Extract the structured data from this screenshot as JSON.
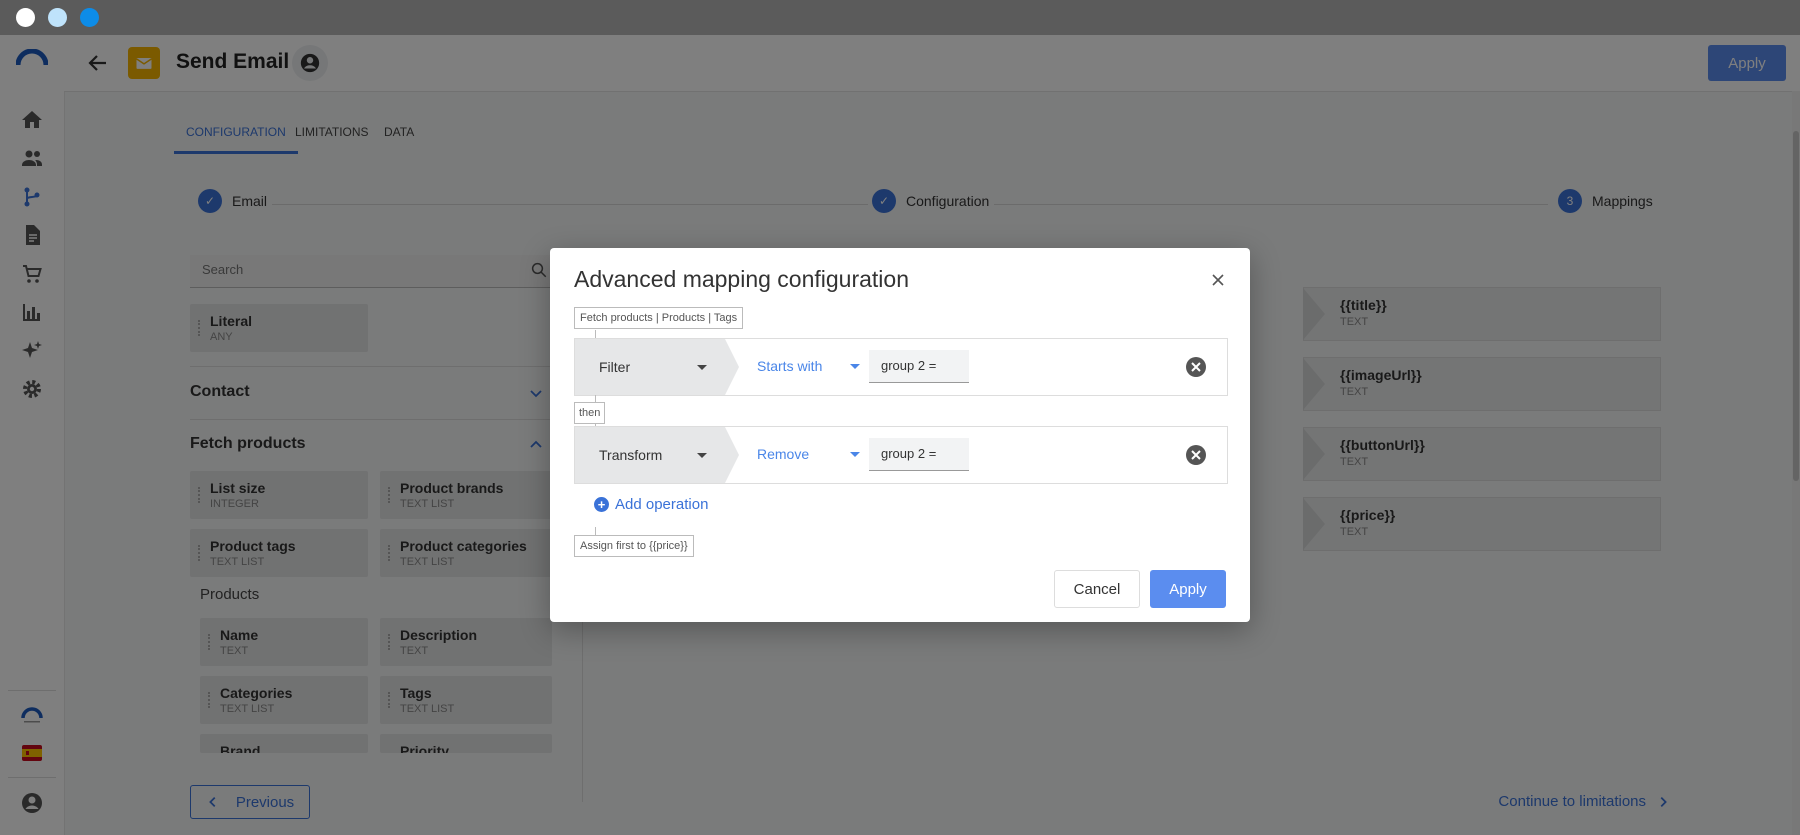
{
  "window": {
    "title_dots": [
      "close",
      "minimize",
      "zoom"
    ]
  },
  "header": {
    "title": "Send Email",
    "apply_label": "Apply"
  },
  "tabs": [
    {
      "label": "CONFIGURATION",
      "active": true
    },
    {
      "label": "LIMITATIONS",
      "active": false
    },
    {
      "label": "DATA",
      "active": false
    }
  ],
  "stepper": [
    {
      "label": "Email",
      "state": "done"
    },
    {
      "label": "Configuration",
      "state": "done"
    },
    {
      "label": "Mappings",
      "state": "current",
      "number": "3"
    }
  ],
  "left_panel": {
    "search_placeholder": "Search",
    "literal": {
      "label": "Literal",
      "type": "ANY"
    },
    "contact_title": "Contact",
    "fetch_title": "Fetch products",
    "fetch_items": [
      {
        "label": "List size",
        "type": "INTEGER"
      },
      {
        "label": "Product brands",
        "type": "TEXT LIST"
      },
      {
        "label": "Product tags",
        "type": "TEXT LIST"
      },
      {
        "label": "Product categories",
        "type": "TEXT LIST"
      }
    ],
    "products_title": "Products",
    "product_items": [
      {
        "label": "Name",
        "type": "TEXT"
      },
      {
        "label": "Description",
        "type": "TEXT"
      },
      {
        "label": "Categories",
        "type": "TEXT LIST"
      },
      {
        "label": "Tags",
        "type": "TEXT LIST"
      },
      {
        "label": "Brand",
        "type": ""
      },
      {
        "label": "Priority",
        "type": ""
      }
    ]
  },
  "targets": [
    {
      "label": "{{title}}",
      "type": "TEXT"
    },
    {
      "label": "{{imageUrl}}",
      "type": "TEXT"
    },
    {
      "label": "{{buttonUrl}}",
      "type": "TEXT"
    },
    {
      "label": "{{price}}",
      "type": "TEXT"
    }
  ],
  "footer": {
    "previous_label": "Previous",
    "continue_label": "Continue to limitations"
  },
  "modal": {
    "title": "Advanced mapping configuration",
    "source_tag": "Fetch products | Products | Tags",
    "then_label": "then",
    "operations": [
      {
        "type": "Filter",
        "mode": "Starts with",
        "value": "group 2 ="
      },
      {
        "type": "Transform",
        "mode": "Remove",
        "value": "group 2 ="
      }
    ],
    "add_operation_label": "Add operation",
    "assign_tag": "Assign first to {{price}}",
    "cancel_label": "Cancel",
    "apply_label": "Apply"
  },
  "colors": {
    "accent": "#3a72d8",
    "button": "#5b8def",
    "email_badge": "#f7b500"
  }
}
